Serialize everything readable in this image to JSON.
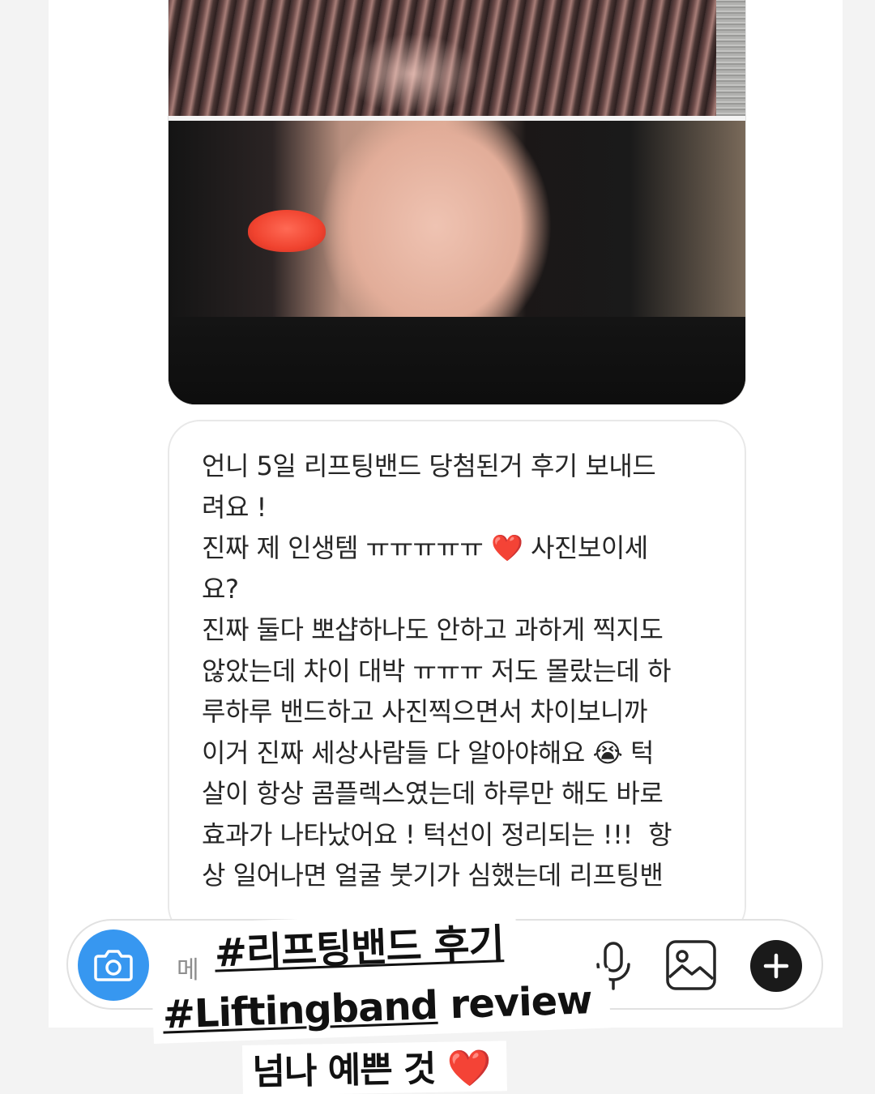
{
  "conversation": {
    "message_text": "언니 5일 리프팅밴드 당첨된거 후기 보내드\n려요 !\n진짜 제 인생템 ㅠㅠㅠㅠㅠ ❤️ 사진보이세\n요?\n진짜 둘다 뽀샵하나도 안하고 과하게 찍지도\n않았는데 차이 대박 ㅠㅠㅠ 저도 몰랐는데 하\n루하루 밴드하고 사진찍으면서 차이보니까\n이거 진짜 세상사람들 다 알아야해요 😭 턱\n살이 항상 콤플렉스였는데 하루만 해도 바로\n효과가 나타났어요 ! 턱선이 정리되는 !!!  항\n상 일어나면 얼굴 붓기가 심했는데 리프팅밴"
  },
  "composer": {
    "placeholder": "메",
    "icons": [
      "camera-icon",
      "microphone-icon",
      "gallery-icon",
      "plus-icon"
    ]
  },
  "overlay": {
    "line1": "#리프팅밴드 후기",
    "line2_tag": "#Liftingband",
    "line2_rest": " review",
    "line3": "넘나 예쁜 것 ",
    "line3_emoji": "❤️"
  },
  "colors": {
    "accent_blue": "#3797f0",
    "lip_red": "#f0432f",
    "heart_red": "#e0242a"
  }
}
